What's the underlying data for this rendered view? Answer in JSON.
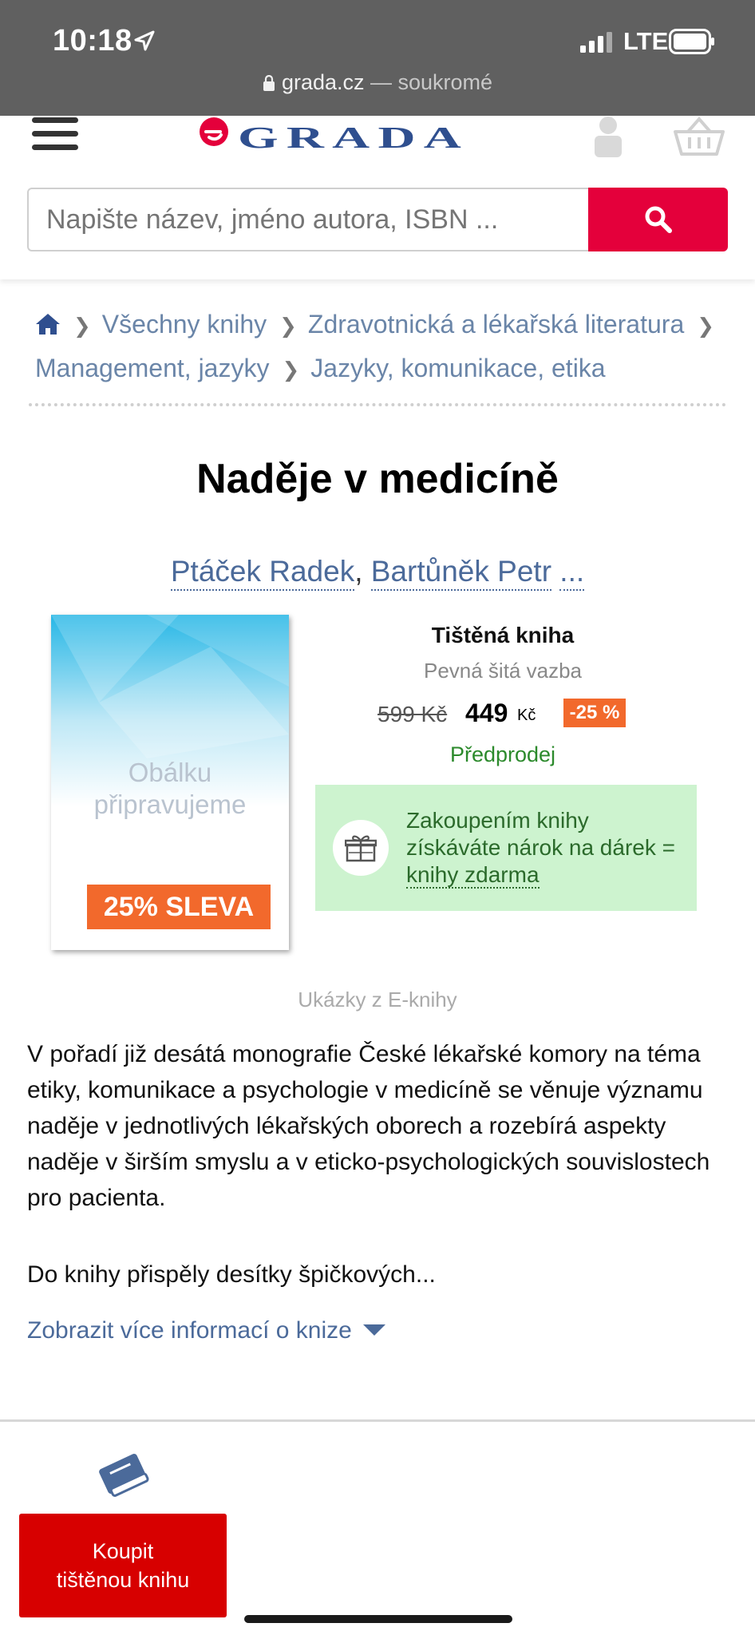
{
  "status_bar": {
    "time": "10:18",
    "network": "LTE"
  },
  "browser": {
    "domain": "grada.cz",
    "mode": " — soukromé"
  },
  "header": {
    "logo_alt": "GRADA",
    "search_placeholder": "Napište název, jméno autora, ISBN ..."
  },
  "breadcrumb": {
    "items": [
      "Všechny knihy",
      "Zdravotnická a lékařská literatura",
      "Management, jazyky",
      "Jazyky, komunikace, etika"
    ]
  },
  "book": {
    "title": "Naděje v medicíně",
    "authors": [
      "Ptáček Radek",
      "Bartůněk Petr",
      "..."
    ],
    "cover_text_line1": "Obálku",
    "cover_text_line2": "připravujeme",
    "cover_sale": "25% SLEVA"
  },
  "offer": {
    "format": "Tištěná kniha",
    "binding": "Pevná šitá vazba",
    "old_price": "599 Kč",
    "new_price": "449",
    "currency": "Kč",
    "discount": "-25 %",
    "availability": "Předprodej",
    "gift_text_1": "Zakoupením knihy získáváte nárok na dárek = ",
    "gift_link": "knihy zdarma"
  },
  "samples_label": "Ukázky z E-knihy",
  "description": {
    "paragraph1": "V pořadí již desátá monografie České lékařské komory na téma etiky, komunikace a psychologie v medicíně se věnuje významu naděje v jednotlivých lékařských oborech a rozebírá aspekty naděje v širším smyslu a v eticko-psychologických souvislostech pro pacienta.",
    "paragraph2": "Do knihy přispěly desítky špičkových...",
    "more_link": "Zobrazit více informací o knize"
  },
  "bottom_bar": {
    "buy_line1": "Koupit",
    "buy_line2": "tištěnou knihu"
  },
  "colors": {
    "brand_red": "#e4003b",
    "discount_orange": "#f2692c",
    "link_blue": "#4b6a9a",
    "gift_green": "#cdf3cf",
    "buy_red": "#d70000"
  }
}
